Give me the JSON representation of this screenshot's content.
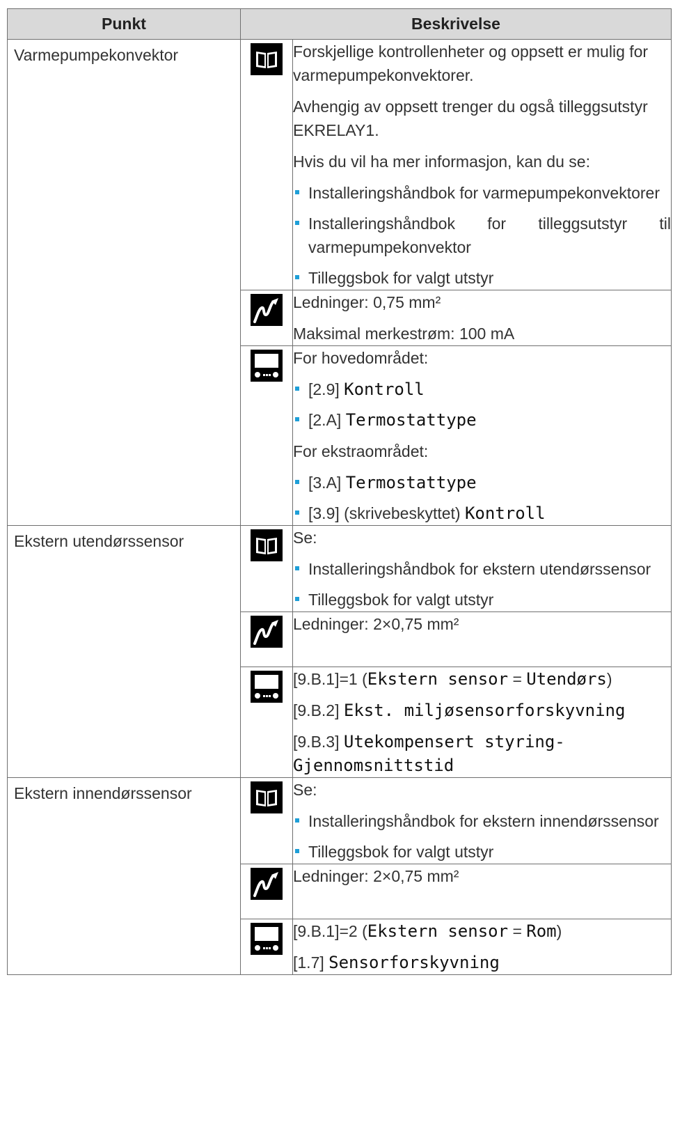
{
  "header": {
    "col1": "Punkt",
    "col2": "Beskrivelse"
  },
  "rows": [
    {
      "item": "Varmepumpekonvektor",
      "book": {
        "p1": "Forskjellige kontrollenheter og oppsett er mulig for varmepumpekonvektorer.",
        "p2": "Avhengig av oppsett trenger du også tilleggsutstyr EKRELAY1.",
        "p3": "Hvis du vil ha mer informasjon, kan du se:",
        "bullets": [
          "Installeringshåndbok for varmepumpekonvektorer",
          "Installeringshåndbok for tilleggsutstyr til varmepumpekonvektor",
          "Tilleggsbok for valgt utstyr"
        ]
      },
      "wire": {
        "l1": "Ledninger: 0,75 mm²",
        "l2": "Maksimal merkestrøm: 100 mA"
      },
      "ui": {
        "h1": "For hovedområdet:",
        "b1_code": "[2.9]",
        "b1_name": "Kontroll",
        "b2_code": "[2.A]",
        "b2_name": "Termostattype",
        "h2": "For ekstraområdet:",
        "b3_code": "[3.A]",
        "b3_name": "Termostattype",
        "b4_code": "[3.9] (skrivebeskyttet)",
        "b4_name": "Kontroll"
      }
    },
    {
      "item": "Ekstern utendørssensor",
      "book": {
        "p1": "Se:",
        "bullets": [
          "Installeringshåndbok for ekstern utendørssensor",
          "Tilleggsbok for valgt utstyr"
        ]
      },
      "wire": {
        "l1": "Ledninger: 2×0,75 mm²"
      },
      "ui": {
        "l1_code": "[9.B.1]=1 (",
        "l1_name": "Ekstern sensor",
        "l1_eq": " = ",
        "l1_val": "Utendørs",
        "l1_end": ")",
        "l2_code": "[9.B.2]",
        "l2_name": "Ekst. miljøsensorforskyvning",
        "l3_code": "[9.B.3]",
        "l3_name": "Utekompensert styring-Gjennomsnittstid"
      }
    },
    {
      "item": "Ekstern innendørssensor",
      "book": {
        "p1": "Se:",
        "bullets": [
          "Installeringshåndbok for ekstern innendørssensor",
          "Tilleggsbok for valgt utstyr"
        ]
      },
      "wire": {
        "l1": "Ledninger: 2×0,75 mm²"
      },
      "ui": {
        "l1_code": "[9.B.1]=2 (",
        "l1_name": "Ekstern sensor",
        "l1_eq": " = ",
        "l1_val": "Rom",
        "l1_end": ")",
        "l2_code": "[1.7]",
        "l2_name": "Sensorforskyvning"
      }
    }
  ],
  "icons": {
    "book": "book-icon",
    "wire": "wire-icon",
    "ui": "user-interface-icon"
  },
  "colors": {
    "bullet": "#1e9fd8",
    "header_bg": "#d9d9d9"
  }
}
